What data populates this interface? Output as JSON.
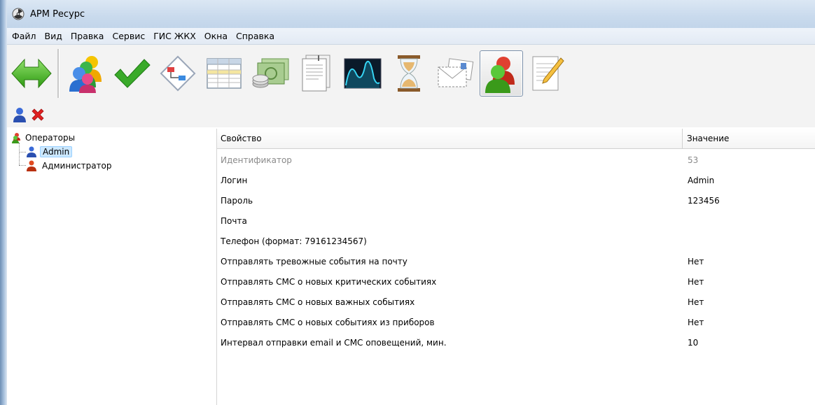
{
  "window": {
    "title": "АРМ Ресурс",
    "app_icon": "radiation-icon"
  },
  "menu": [
    "Файл",
    "Вид",
    "Правка",
    "Сервис",
    "ГИС ЖКХ",
    "Окна",
    "Справка"
  ],
  "toolbar": {
    "buttons": [
      {
        "icon": "green-double-arrow-icon"
      },
      {
        "icon": "users-group-icon"
      },
      {
        "icon": "checkmark-icon"
      },
      {
        "icon": "flowchart-icon"
      },
      {
        "icon": "table-icon"
      },
      {
        "icon": "money-coins-icon"
      },
      {
        "icon": "documents-icon"
      },
      {
        "icon": "waveform-chart-icon"
      },
      {
        "icon": "hourglass-icon"
      },
      {
        "icon": "envelope-letters-icon"
      },
      {
        "icon": "operators-icon",
        "active": true
      },
      {
        "icon": "notepad-pencil-icon"
      }
    ]
  },
  "subtoolbar": [
    {
      "icon": "add-user-icon"
    },
    {
      "icon": "delete-x-icon"
    }
  ],
  "tree": {
    "root": {
      "label": "Операторы",
      "icon": "operators-icon"
    },
    "children": [
      {
        "label": "Admin",
        "icon": "user-blue-icon",
        "selected": true
      },
      {
        "label": "Администратор",
        "icon": "user-red-icon",
        "selected": false
      }
    ]
  },
  "grid": {
    "columns": {
      "property": "Свойство",
      "value": "Значение"
    },
    "rows": [
      {
        "property": "Идентификатор",
        "value": "53",
        "disabled": true
      },
      {
        "property": "Логин",
        "value": "Admin"
      },
      {
        "property": "Пароль",
        "value": "123456"
      },
      {
        "property": "Почта",
        "value": ""
      },
      {
        "property": "Телефон (формат: 79161234567)",
        "value": ""
      },
      {
        "property": "Отправлять тревожные события на почту",
        "value": "Нет"
      },
      {
        "property": "Отправлять СМС о новых критических событиях",
        "value": "Нет"
      },
      {
        "property": "Отправлять СМС о новых важных событиях",
        "value": "Нет"
      },
      {
        "property": "Отправлять СМС о новых событиях из приборов",
        "value": "Нет"
      },
      {
        "property": "Интервал отправки email и СМС оповещений, мин.",
        "value": "10"
      }
    ]
  }
}
